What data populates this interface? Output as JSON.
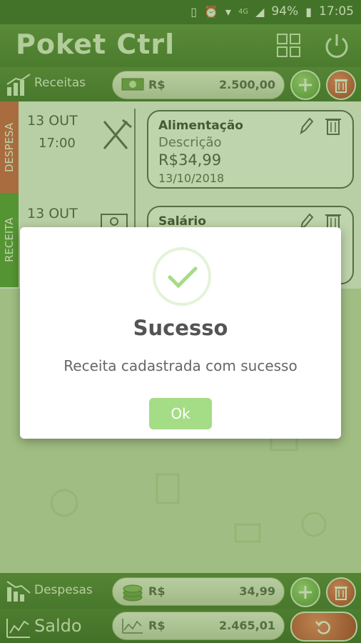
{
  "status_bar": {
    "battery": "94%",
    "time": "17:05",
    "network": "4G"
  },
  "header": {
    "title": "Poket Ctrl"
  },
  "receitas": {
    "label": "Receitas",
    "currency": "R$",
    "amount": "2.500,00"
  },
  "tabs": {
    "despesa": "DESPESA",
    "receita": "RECEITA"
  },
  "entries": [
    {
      "day": "13 OUT",
      "time": "17:00",
      "category": "Alimentação",
      "description": "Descrição",
      "amount": "R$34,99",
      "date": "13/10/2018"
    },
    {
      "day": "13 OUT",
      "category": "Salário"
    }
  ],
  "despesas": {
    "label": "Despesas",
    "currency": "R$",
    "amount": "34,99"
  },
  "saldo": {
    "label": "Saldo",
    "currency": "R$",
    "amount": "2.465,01"
  },
  "dialog": {
    "title": "Sucesso",
    "message": "Receita cadastrada com sucesso",
    "ok_label": "Ok"
  },
  "colors": {
    "brand_green": "#2e5f1a",
    "success_green": "#a5dc86",
    "delete_red": "#a8180e",
    "despesa_red": "#d9423a"
  }
}
